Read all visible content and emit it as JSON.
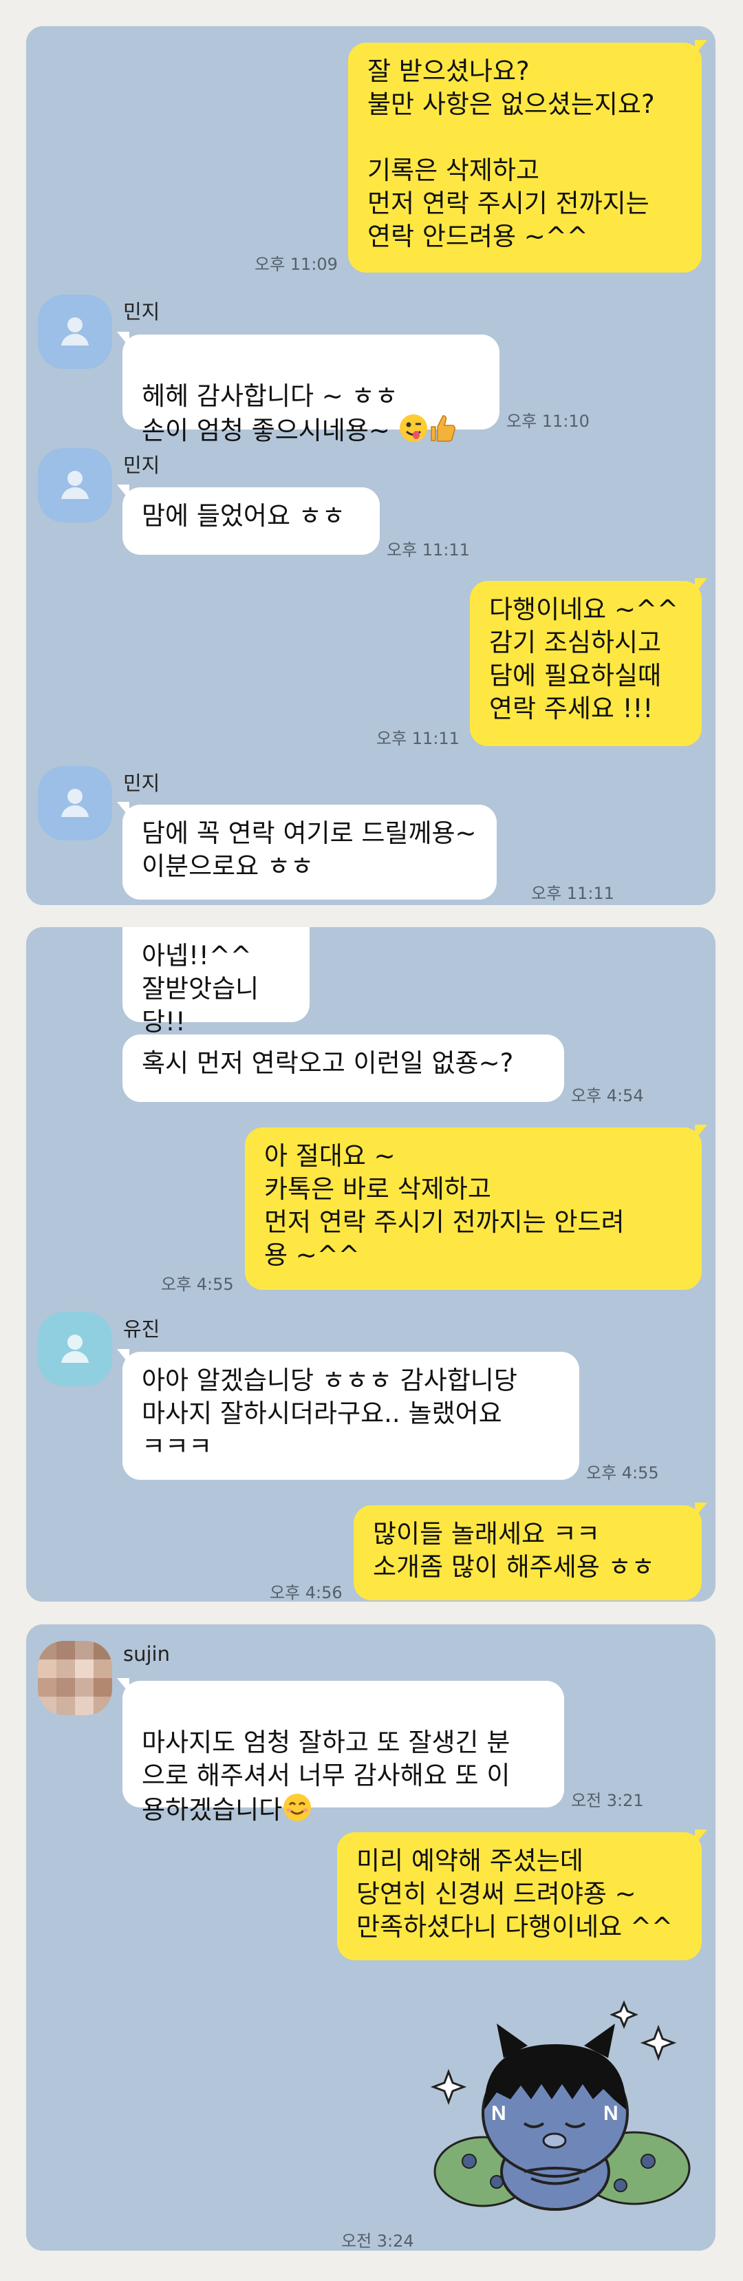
{
  "panel1": {
    "msg1": {
      "text": "잘 받으셨나요?\n불만 사항은 없으셨는지요?\n\n기록은 삭제하고\n먼저 연락 주시기 전까지는\n연락 안드려용 ~^^",
      "time": "오후 11:09"
    },
    "sender1": "민지",
    "msg2": {
      "text": "헤헤 감사합니다 ~ ㅎㅎ\n손이 엄청 좋으시네용~ ",
      "time": "오후 11:10"
    },
    "sender2": "민지",
    "msg3": {
      "text": "맘에 들었어요 ㅎㅎ",
      "time": "오후 11:11"
    },
    "msg4": {
      "text": "다행이네요 ~^^\n감기 조심하시고\n담에 필요하실때\n연락 주세요 !!!",
      "time": "오후 11:11"
    },
    "sender3": "민지",
    "msg5": {
      "text": "담에 꼭 연락 여기로 드릴께용~\n이분으로요 ㅎㅎ",
      "time": "오후 11:11"
    }
  },
  "panel2": {
    "msg1": {
      "text": "아넵!!^^\n잘받앗습니당!!"
    },
    "msg2": {
      "text": "혹시 먼저 연락오고 이런일 없죵~?",
      "time": "오후 4:54"
    },
    "msg3": {
      "text": "아 절대요 ~\n카톡은 바로 삭제하고\n먼저 연락 주시기 전까지는 안드려\n용 ~^^",
      "time": "오후 4:55"
    },
    "sender1": "유진",
    "msg4": {
      "text": "아아 알겠습니당 ㅎㅎㅎ 감사합니당\n마사지 잘하시더라구요.. 놀랬어요\nㅋㅋㅋ",
      "time": "오후 4:55"
    },
    "msg5": {
      "text": "많이들 놀래세요 ㅋㅋ\n소개좀 많이 해주세용 ㅎㅎ",
      "time": "오후 4:56"
    }
  },
  "panel3": {
    "sender1": "sujin",
    "msg1": {
      "text": "마사지도 엄청 잘하고 또 잘생긴 분\n으로 해주셔서 너무 감사해요 또 이\n용하겠습니다",
      "time": "오전 3:21"
    },
    "msg2": {
      "text": "미리 예약해 주셨는데\n당연히 신경써 드려야죵 ~\n만족하셨다니 다행이네요 ^^"
    },
    "sticker": {
      "icon": "cat-sticker-icon",
      "time": "오전 3:24"
    }
  },
  "colors": {
    "outgoing": "#fee742",
    "incoming": "#ffffff",
    "chat_bg": "#b3c5d8",
    "page_bg": "#f1efec"
  }
}
